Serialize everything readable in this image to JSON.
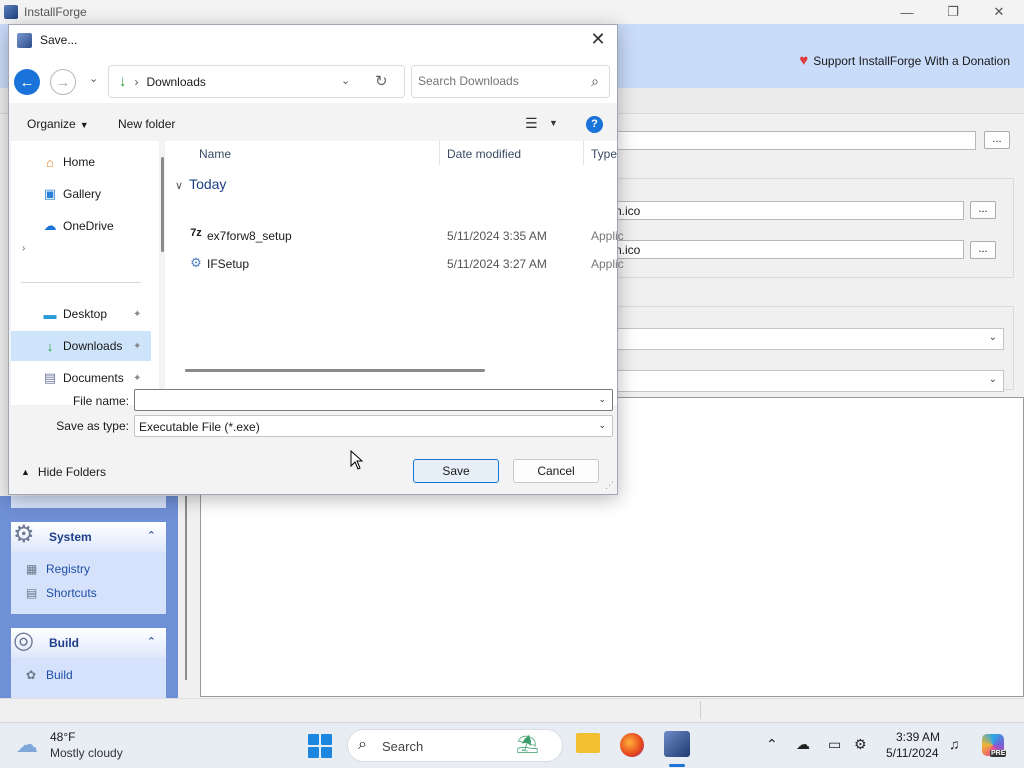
{
  "app": {
    "title": "InstallForge",
    "minimize": "—",
    "maximize": "❐",
    "close": "✕",
    "donation_text": "Support InstallForge With a Donation",
    "field1_value": "n.ico",
    "field2_value": "n.ico",
    "browse_label": "...",
    "sidebar": {
      "system_header": "System",
      "system_items": [
        "Registry",
        "Shortcuts"
      ],
      "build_header": "Build",
      "build_items": [
        "Build"
      ],
      "collapse_glyph": "⌃"
    }
  },
  "dialog": {
    "title": "Save...",
    "close": "✕",
    "address": {
      "separator": "›",
      "location": "Downloads"
    },
    "search_placeholder": "Search Downloads",
    "toolbar": {
      "organize": "Organize",
      "new_folder": "New folder",
      "help": "?"
    },
    "nav_items": [
      {
        "label": "Home",
        "icon": "home-icon"
      },
      {
        "label": "Gallery",
        "icon": "gallery-icon"
      },
      {
        "label": "OneDrive",
        "icon": "onedrive-icon"
      },
      {
        "label": "Desktop",
        "icon": "desktop-icon",
        "pinned": true
      },
      {
        "label": "Downloads",
        "icon": "downloads-icon",
        "pinned": true,
        "selected": true
      },
      {
        "label": "Documents",
        "icon": "documents-icon",
        "pinned": true
      }
    ],
    "columns": [
      "Name",
      "Date modified",
      "Type"
    ],
    "group": "Today",
    "files": [
      {
        "name": "ex7forw8_setup",
        "date": "5/11/2024 3:35 AM",
        "type": "Applic",
        "icon": "7zip-sfx-icon"
      },
      {
        "name": "IFSetup",
        "date": "5/11/2024 3:27 AM",
        "type": "Applic",
        "icon": "setup-icon"
      }
    ],
    "file_name_label": "File name:",
    "file_name_value": "",
    "save_type_label": "Save as type:",
    "save_type_value": "Executable File (*.exe)",
    "hide_folders": "Hide Folders",
    "save": "Save",
    "cancel": "Cancel"
  },
  "taskbar": {
    "weather_temp": "48°F",
    "weather_condition": "Mostly cloudy",
    "search_label": "Search",
    "time": "3:39 AM",
    "date": "5/11/2024",
    "copilot_badge": "PRE"
  },
  "colors": {
    "accent": "#1a73d9",
    "banner": "#c9dcfa",
    "sidebar": "#6f8fd6",
    "selection": "#cde4fa"
  }
}
